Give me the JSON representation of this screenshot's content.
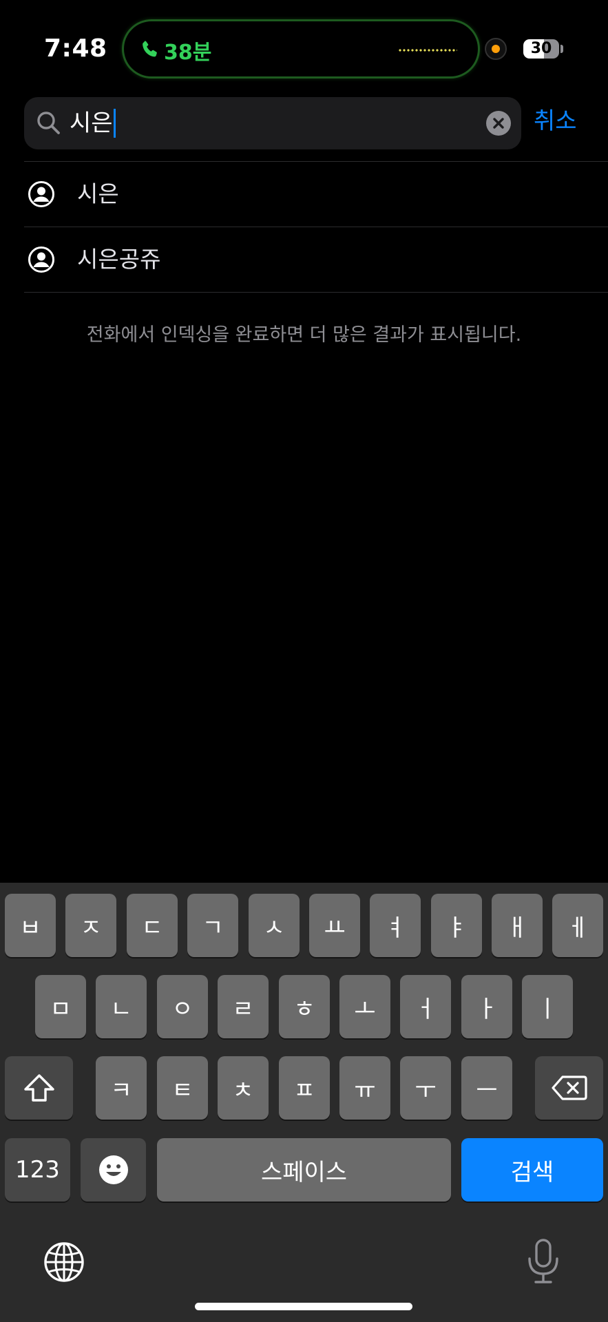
{
  "status_bar": {
    "time": "7:48",
    "call_duration": "38분",
    "battery_level": "30",
    "call_color": "#33d15a",
    "recording_color": "#ff9f0a"
  },
  "search": {
    "query": "시은",
    "cancel_label": "취소",
    "accent_color": "#0a84ff"
  },
  "results": [
    {
      "label": "시은",
      "icon": "person-circle-icon"
    },
    {
      "label": "시은공쥬",
      "icon": "person-circle-icon"
    }
  ],
  "info_message": "전화에서 인덱싱을 완료하면 더 많은 결과가 표시됩니다.",
  "keyboard": {
    "row1": [
      "ㅂ",
      "ㅈ",
      "ㄷ",
      "ㄱ",
      "ㅅ",
      "ㅛ",
      "ㅕ",
      "ㅑ",
      "ㅐ",
      "ㅔ"
    ],
    "row2": [
      "ㅁ",
      "ㄴ",
      "ㅇ",
      "ㄹ",
      "ㅎ",
      "ㅗ",
      "ㅓ",
      "ㅏ",
      "ㅣ"
    ],
    "row3": [
      "ㅋ",
      "ㅌ",
      "ㅊ",
      "ㅍ",
      "ㅠ",
      "ㅜ",
      "ㅡ"
    ],
    "numbers_label": "123",
    "space_label": "스페이스",
    "search_label": "검색",
    "shift_icon": "shift-arrow-icon",
    "delete_icon": "delete-backspace-icon",
    "emoji_icon": "emoji-smile-icon",
    "globe_icon": "globe-icon",
    "mic_icon": "microphone-icon"
  }
}
